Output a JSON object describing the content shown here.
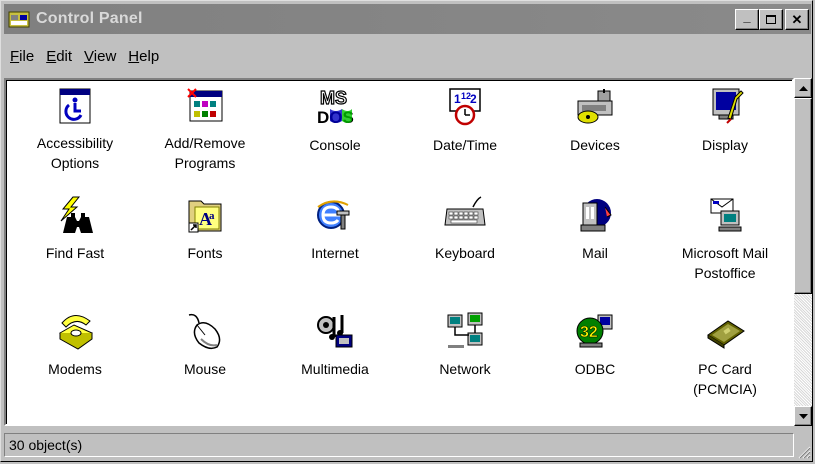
{
  "window": {
    "title": "Control Panel",
    "buttons": {
      "minimize": "_",
      "maximize": "□",
      "close": "✕"
    }
  },
  "menu": [
    {
      "label": "File",
      "key": "F",
      "rest": "ile"
    },
    {
      "label": "Edit",
      "key": "E",
      "rest": "dit"
    },
    {
      "label": "View",
      "key": "V",
      "rest": "iew"
    },
    {
      "label": "Help",
      "key": "H",
      "rest": "elp"
    }
  ],
  "icons": [
    {
      "label": "Accessibility\nOptions",
      "icon": "accessibility-icon"
    },
    {
      "label": "Add/Remove\nPrograms",
      "icon": "add-remove-programs-icon"
    },
    {
      "label": "Console",
      "icon": "console-icon"
    },
    {
      "label": "Date/Time",
      "icon": "date-time-icon"
    },
    {
      "label": "Devices",
      "icon": "devices-icon"
    },
    {
      "label": "Display",
      "icon": "display-icon"
    },
    {
      "label": "Find Fast",
      "icon": "find-fast-icon"
    },
    {
      "label": "Fonts",
      "icon": "fonts-icon"
    },
    {
      "label": "Internet",
      "icon": "internet-icon"
    },
    {
      "label": "Keyboard",
      "icon": "keyboard-icon"
    },
    {
      "label": "Mail",
      "icon": "mail-icon"
    },
    {
      "label": "Microsoft Mail\nPostoffice",
      "icon": "mail-postoffice-icon"
    },
    {
      "label": "Modems",
      "icon": "modems-icon"
    },
    {
      "label": "Mouse",
      "icon": "mouse-icon"
    },
    {
      "label": "Multimedia",
      "icon": "multimedia-icon"
    },
    {
      "label": "Network",
      "icon": "network-icon"
    },
    {
      "label": "ODBC",
      "icon": "odbc-icon"
    },
    {
      "label": "PC Card\n(PCMCIA)",
      "icon": "pc-card-icon"
    }
  ],
  "console_text": {
    "top": "MS",
    "bottom": "DOS"
  },
  "odbc_text": "32",
  "status": {
    "text": "30 object(s)"
  },
  "colors": {
    "titlebar": "#808080",
    "content_bg": "#ffffff",
    "chrome": "#c0c0c0"
  }
}
